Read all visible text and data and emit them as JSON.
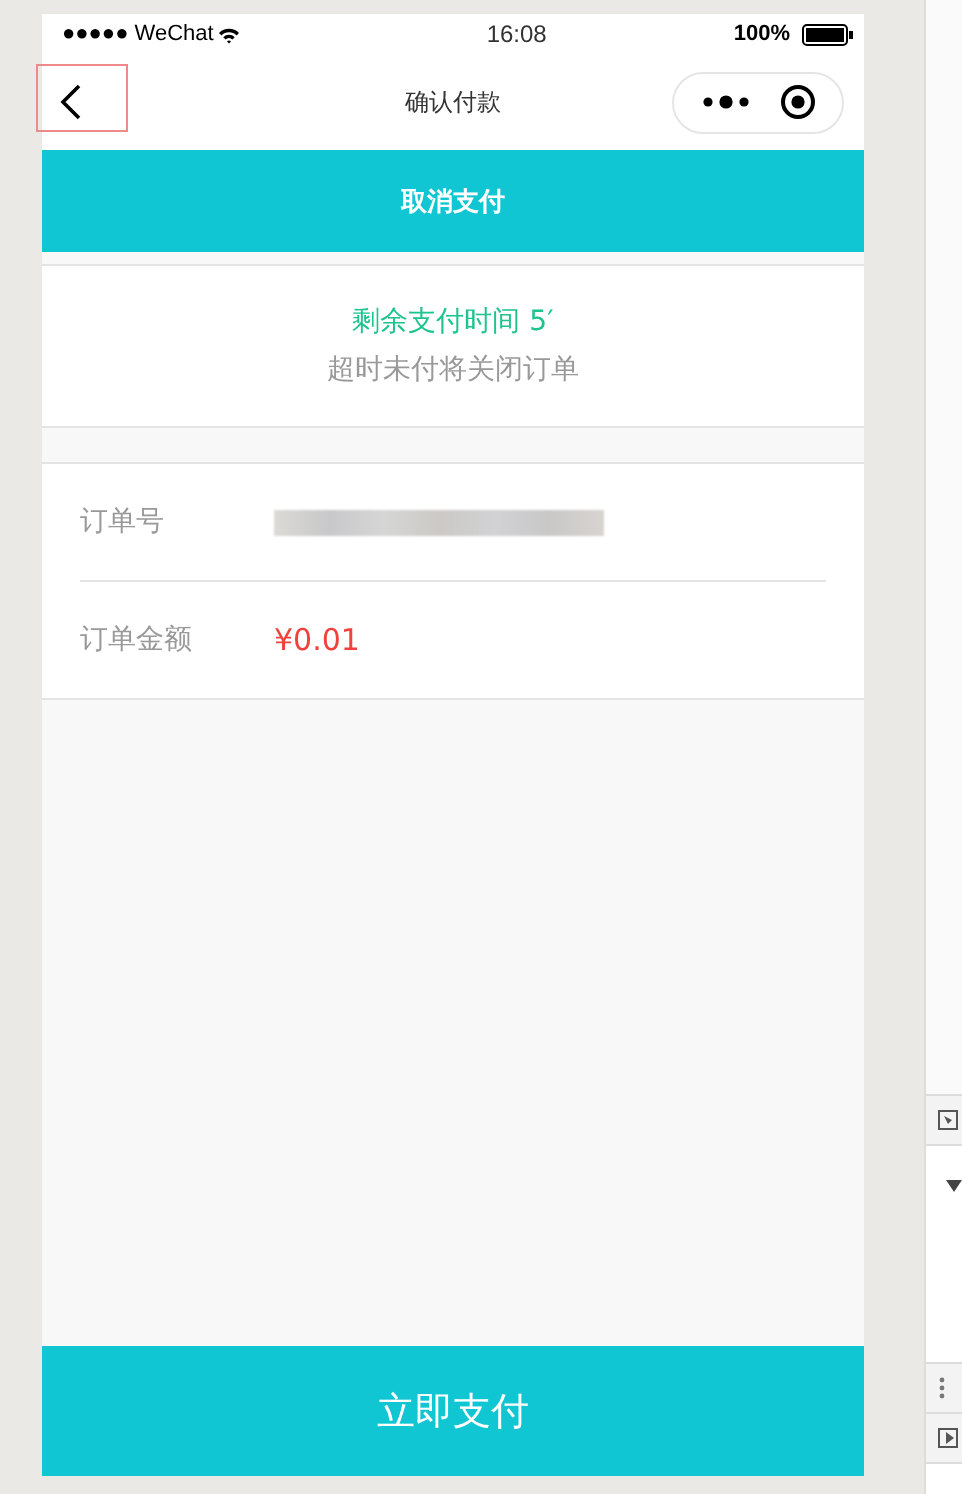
{
  "status_bar": {
    "carrier": "●●●●● WeChat",
    "time": "16:08",
    "battery": "100%"
  },
  "nav_bar": {
    "title": "确认付款"
  },
  "cancel_button": {
    "label": "取消支付"
  },
  "notice": {
    "countdown": "剩余支付时间 5′",
    "hint": "超时未付将关闭订单"
  },
  "order": {
    "rows": [
      {
        "label": "订单号",
        "kind": "hidden"
      },
      {
        "label": "订单金额",
        "kind": "amount",
        "value": "¥0.01"
      }
    ]
  },
  "pay_button": {
    "label": "立即支付"
  }
}
